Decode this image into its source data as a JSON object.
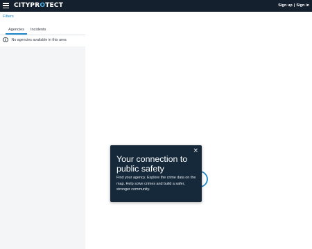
{
  "header": {
    "logo_part1": "CITYPR",
    "logo_accent": "O",
    "logo_part2": "TECT",
    "sign_up": "Sign up",
    "separator": "|",
    "sign_in": "Sign in"
  },
  "sidebar": {
    "filters_label": "Filters",
    "tabs": [
      {
        "label": "Agencies",
        "active": true
      },
      {
        "label": "Incidents",
        "active": false
      }
    ],
    "notice": "No agencies available in this area"
  },
  "popup": {
    "title": "Your connection to public safety",
    "body": "Find your agency. Explore the crime data on the map. Help solve crimes and build a safer, stronger community.",
    "close_icon": "×"
  },
  "colors": {
    "header_bg": "#14202e",
    "accent": "#1e88c8",
    "popup_bg": "#15293b",
    "sidebar_bg": "#f4f5f7",
    "spinner": "#1e88c8"
  },
  "icons": {
    "menu": "hamburger-icon",
    "info": "info-icon",
    "close": "close-icon",
    "loading": "spinner-icon"
  }
}
